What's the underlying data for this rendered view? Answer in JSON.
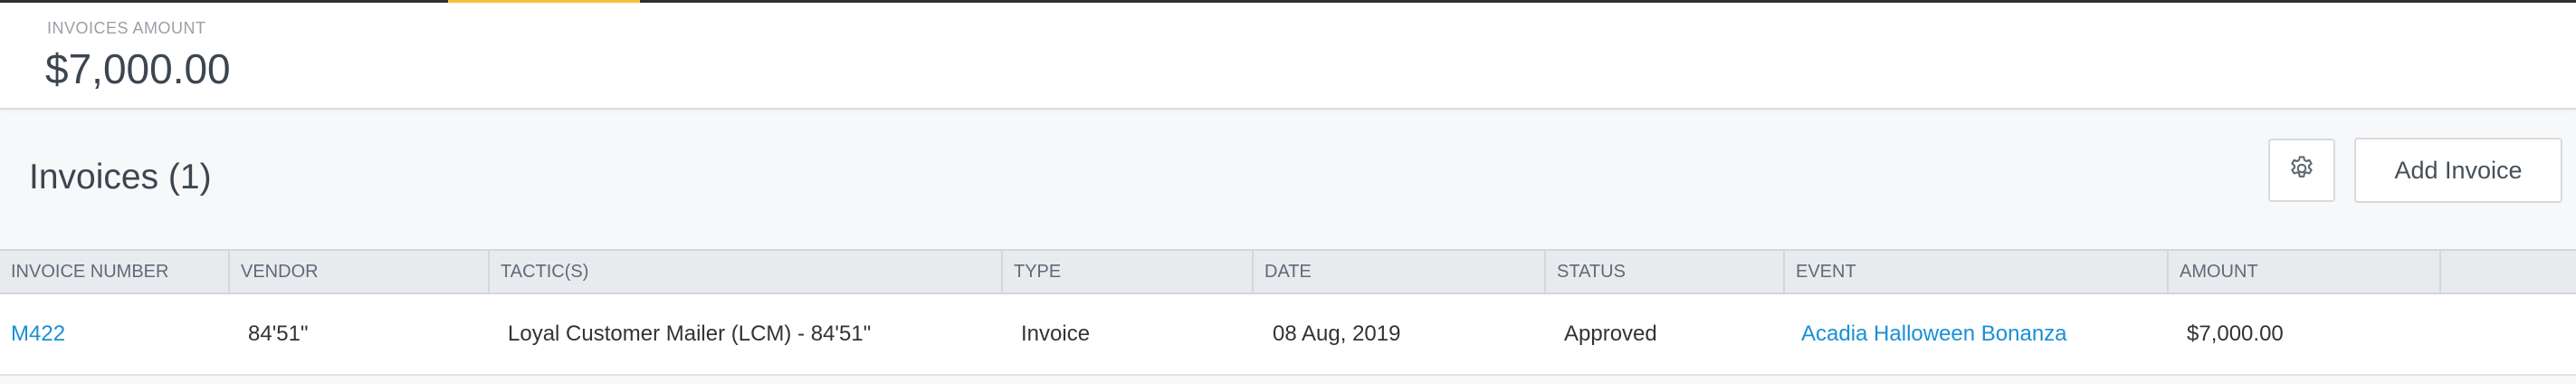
{
  "summary": {
    "label": "INVOICES AMOUNT",
    "value": "$7,000.00"
  },
  "section": {
    "title": "Invoices (1)"
  },
  "actions": {
    "settings_icon": "gear-icon",
    "add_label": "Add Invoice"
  },
  "table": {
    "headers": [
      "INVOICE NUMBER",
      "VENDOR",
      "TACTIC(S)",
      "TYPE",
      "DATE",
      "STATUS",
      "EVENT",
      "AMOUNT"
    ],
    "rows": [
      {
        "invoice_number": "M422",
        "vendor": "84'51\"",
        "tactics": "Loyal Customer Mailer (LCM) - 84'51\"",
        "type": "Invoice",
        "date": "08 Aug, 2019",
        "status": "Approved",
        "event": "Acadia Halloween Bonanza",
        "amount": "$7,000.00"
      }
    ]
  },
  "colors": {
    "accent": "#f5c33b",
    "link": "#1a8fd6",
    "header_bg": "#e8ebee"
  }
}
